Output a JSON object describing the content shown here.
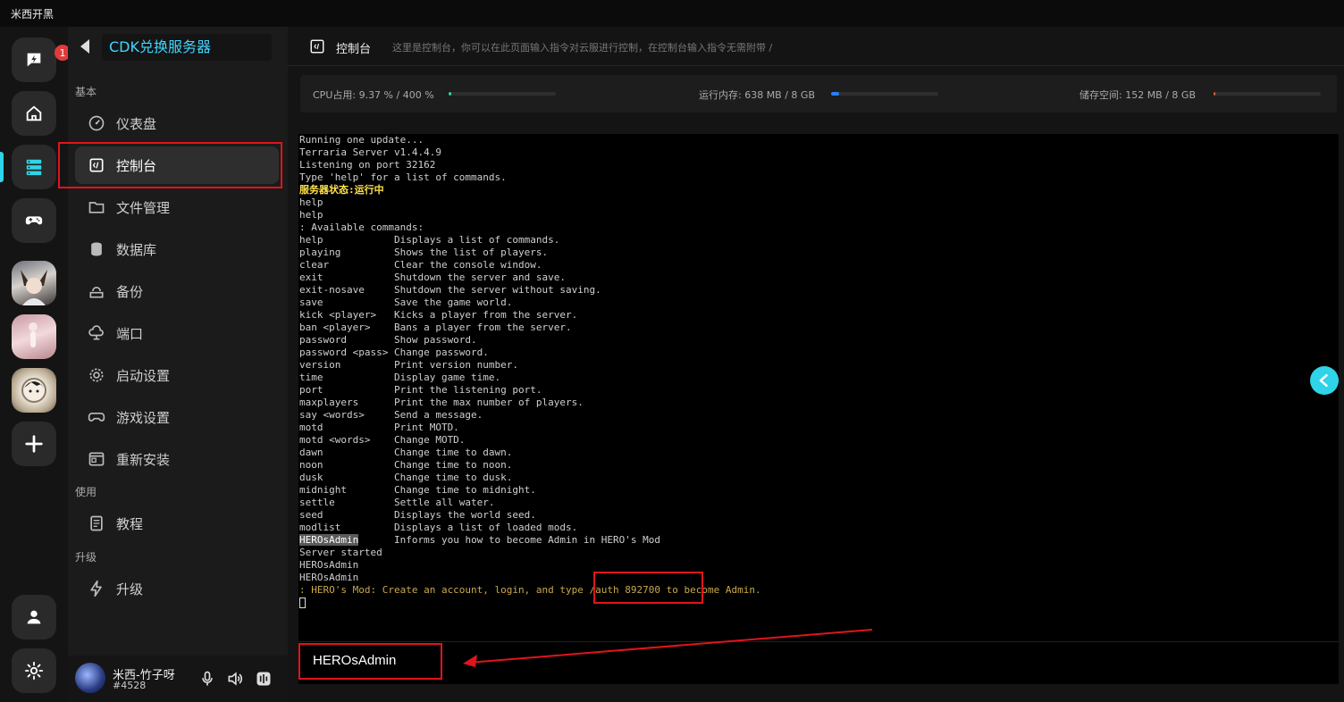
{
  "app": {
    "title": "米西开黑"
  },
  "rail": {
    "notification_count": "1"
  },
  "server": {
    "name": "CDK兑换服务器"
  },
  "sidebar": {
    "sections": {
      "basic": "基本",
      "use": "使用",
      "upgrade": "升级"
    },
    "items": [
      {
        "label": "仪表盘"
      },
      {
        "label": "控制台"
      },
      {
        "label": "文件管理"
      },
      {
        "label": "数据库"
      },
      {
        "label": "备份"
      },
      {
        "label": "端口"
      },
      {
        "label": "启动设置"
      },
      {
        "label": "游戏设置"
      },
      {
        "label": "重新安装"
      },
      {
        "label": "教程"
      },
      {
        "label": "升级"
      }
    ]
  },
  "user": {
    "name": "米西-竹子呀",
    "tag": "#4528"
  },
  "header": {
    "title": "控制台",
    "description": "这里是控制台，你可以在此页面输入指令对云服进行控制，在控制台输入指令无需附带 /"
  },
  "stats": {
    "cpu": {
      "label": "CPU占用: 9.37 % / 400 %",
      "percent": 2.3
    },
    "memory": {
      "label": "运行内存: 638 MB / 8 GB",
      "percent": 7.8
    },
    "storage": {
      "label": "储存空间: 152 MB / 8 GB",
      "percent": 1.9
    },
    "accent_colors": {
      "cpu": "#2fd4a8",
      "memory": "#2a7fff",
      "storage": "#e06a3b"
    }
  },
  "console": {
    "lines": [
      "Running one update...",
      "Terraria Server v1.4.4.9",
      "Listening on port 32162",
      "Type 'help' for a list of commands.",
      "服务器状态:运行中",
      "help",
      "help",
      ": Available commands:",
      "help            Displays a list of commands.",
      "playing         Shows the list of players.",
      "clear           Clear the console window.",
      "exit            Shutdown the server and save.",
      "exit-nosave     Shutdown the server without saving.",
      "save            Save the game world.",
      "kick <player>   Kicks a player from the server.",
      "ban <player>    Bans a player from the server.",
      "password        Show password.",
      "password <pass> Change password.",
      "version         Print version number.",
      "time            Display game time.",
      "port            Print the listening port.",
      "maxplayers      Print the max number of players.",
      "say <words>     Send a message.",
      "motd            Print MOTD.",
      "motd <words>    Change MOTD.",
      "dawn            Change time to dawn.",
      "noon            Change time to noon.",
      "dusk            Change time to dusk.",
      "midnight        Change time to midnight.",
      "settle          Settle all water.",
      "seed            Displays the world seed.",
      "modlist         Displays a list of loaded mods.",
      "HEROsAdmin      Informs you how to become Admin in HERO's Mod",
      "Server started",
      "HEROsAdmin",
      "HEROsAdmin",
      ": HERO's Mod: Create an account, login, and type /auth 892700 to become Admin."
    ]
  },
  "command": {
    "value": "HEROsAdmin"
  }
}
